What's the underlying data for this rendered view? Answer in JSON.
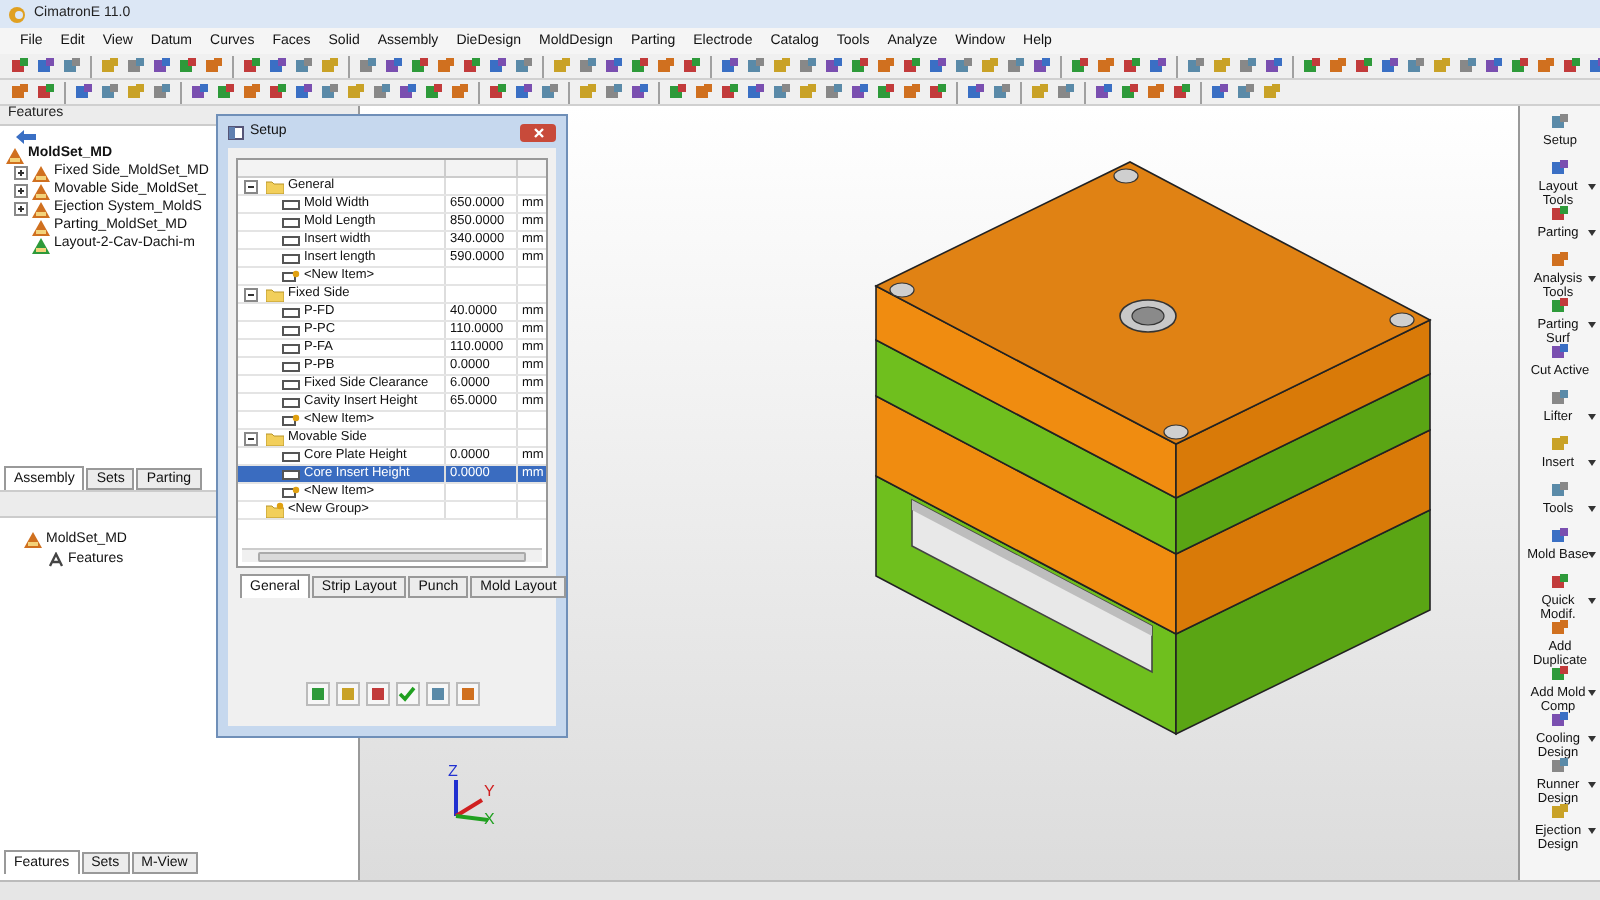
{
  "window": {
    "title": "CimatronE 11.0"
  },
  "menu": [
    "File",
    "Edit",
    "View",
    "Datum",
    "Curves",
    "Faces",
    "Solid",
    "Assembly",
    "DieDesign",
    "MoldDesign",
    "Parting",
    "Electrode",
    "Catalog",
    "Tools",
    "Analyze",
    "Window",
    "Help"
  ],
  "feature_panel": {
    "title": "Features",
    "tree": [
      {
        "label": "MoldSet_MD",
        "expanded": true,
        "children": [
          {
            "label": "Fixed Side_MoldSet_MD",
            "expanded": false,
            "kind": "assembly"
          },
          {
            "label": "Movable Side_MoldSet_",
            "expanded": false,
            "kind": "assembly"
          },
          {
            "label": "Ejection System_MoldS",
            "expanded": false,
            "kind": "assembly"
          },
          {
            "label": "Parting_MoldSet_MD",
            "kind": "part"
          },
          {
            "label": "Layout-2-Cav-Dachi-m",
            "kind": "layout"
          }
        ]
      }
    ],
    "tabs": [
      {
        "label": "Assembly",
        "selected": true
      },
      {
        "label": "Sets",
        "selected": false
      },
      {
        "label": "Parting",
        "selected": false
      }
    ]
  },
  "tree_panel": {
    "tree": [
      {
        "label": "MoldSet_MD",
        "children": [
          {
            "label": "Features"
          }
        ]
      }
    ],
    "tabs": [
      {
        "label": "Features",
        "selected": true
      },
      {
        "label": "Sets",
        "selected": false
      },
      {
        "label": "M-View",
        "selected": false
      }
    ]
  },
  "setup_dialog": {
    "title": "Setup",
    "groups": [
      {
        "label": "General",
        "kind": "group",
        "expanded": true,
        "items": [
          {
            "name": "Mold Width",
            "value": "650.0000",
            "unit": "mm",
            "kind": "param",
            "selected": false
          },
          {
            "name": "Mold Length",
            "value": "850.0000",
            "unit": "mm",
            "kind": "param",
            "selected": false
          },
          {
            "name": "Insert width",
            "value": "340.0000",
            "unit": "mm",
            "kind": "param",
            "selected": false
          },
          {
            "name": "Insert length",
            "value": "590.0000",
            "unit": "mm",
            "kind": "param",
            "selected": false
          },
          {
            "name": "<New Item>",
            "kind": "new",
            "selected": false
          }
        ]
      },
      {
        "label": "Fixed Side",
        "kind": "group",
        "expanded": true,
        "items": [
          {
            "name": "P-FD",
            "value": "40.0000",
            "unit": "mm",
            "kind": "param",
            "selected": false
          },
          {
            "name": "P-PC",
            "value": "110.0000",
            "unit": "mm",
            "kind": "param",
            "selected": false
          },
          {
            "name": "P-FA",
            "value": "110.0000",
            "unit": "mm",
            "kind": "param",
            "selected": false
          },
          {
            "name": "P-PB",
            "value": "0.0000",
            "unit": "mm",
            "kind": "param",
            "selected": false
          },
          {
            "name": "Fixed Side Clearance",
            "value": "6.0000",
            "unit": "mm",
            "kind": "param",
            "selected": false
          },
          {
            "name": "Cavity Insert Height",
            "value": "65.0000",
            "unit": "mm",
            "kind": "param",
            "selected": false
          },
          {
            "name": "<New Item>",
            "kind": "new",
            "selected": false
          }
        ]
      },
      {
        "label": "Movable Side",
        "kind": "group",
        "expanded": true,
        "items": [
          {
            "name": "Core Plate Height",
            "value": "0.0000",
            "unit": "mm",
            "kind": "param",
            "selected": false
          },
          {
            "name": "Core Insert Height",
            "value": "0.0000",
            "unit": "mm",
            "kind": "param",
            "selected": true
          },
          {
            "name": "<New Item>",
            "kind": "new",
            "selected": false
          }
        ]
      },
      {
        "label": "<New Group>",
        "kind": "new"
      }
    ],
    "tabs": [
      {
        "label": "General",
        "selected": true
      },
      {
        "label": "Strip Layout",
        "selected": false
      },
      {
        "label": "Punch",
        "selected": false
      },
      {
        "label": "Mold Layout",
        "selected": false
      }
    ]
  },
  "viewport": {
    "axis_labels": [
      "Z",
      "Y",
      "X"
    ]
  },
  "right_toolbar": [
    {
      "label": "Setup",
      "dropdown": false
    },
    {
      "label": "Layout Tools",
      "dropdown": true
    },
    {
      "label": "Parting",
      "dropdown": true
    },
    {
      "label": "Analysis Tools",
      "dropdown": true
    },
    {
      "label": "Parting Surf",
      "dropdown": true
    },
    {
      "label": "Cut Active",
      "dropdown": false
    },
    {
      "label": "Lifter",
      "dropdown": true
    },
    {
      "label": "Insert",
      "dropdown": true
    },
    {
      "label": "Tools",
      "dropdown": true
    },
    {
      "label": "Mold Base",
      "dropdown": true
    },
    {
      "label": "Quick Modif.",
      "dropdown": true
    },
    {
      "label": "Add Duplicate",
      "dropdown": false
    },
    {
      "label": "Add Mold Comp",
      "dropdown": true
    },
    {
      "label": "Cooling Design",
      "dropdown": true
    },
    {
      "label": "Runner Design",
      "dropdown": true
    },
    {
      "label": "Ejection Design",
      "dropdown": true
    }
  ]
}
